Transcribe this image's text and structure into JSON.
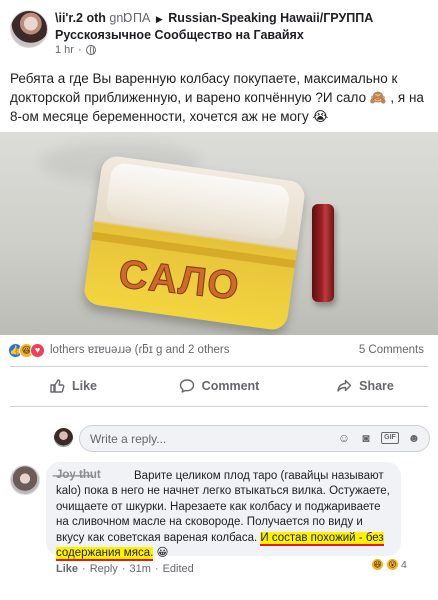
{
  "post": {
    "author_line": "\\ii'r.2 oth",
    "author_suffix": "ɡnⱰПА",
    "group_name": "Russian-Speaking Hawaii/ГРУППА Русскоязычное Сообщество на Гавайях",
    "time": "1 hr",
    "text": "Ребята а где Вы варенную колбасу покупаете, максимально к докторской приближенную, и варено копчённую ?И сало 🙈 , я на 8-ом месяце беременности, хочется аж не могу 😭",
    "photo_label": "CAЛO"
  },
  "reactions": {
    "summary": "lothers ɐɪɐuǝɹɹǝ (ɾƃɪ ɡ and 2 others",
    "comments_count": "5 Comments"
  },
  "actions": {
    "like": "Like",
    "comment": "Comment",
    "share": "Share"
  },
  "composer": {
    "placeholder": "Write a reply..."
  },
  "comment": {
    "author": "̶J̶o̶y̶ ̶t̶h̶ut",
    "text_plain": "Варите целиком плод таро (гавайцы называют kalo) пока в него не начнет легко втыкаться вилка. Остужаете, очищаете от шкурки. Нарезаете как колбасу и поджариваете на сливочном масле на сковороде. Получается по виду и вкусу как советская вареная колбаса. ",
    "text_highlight": "И состав похожий - без содержания мяса.",
    "text_end": " 😀",
    "reaction_count": "4",
    "like": "Like",
    "reply": "Reply",
    "time": "31m",
    "edited": "Edited"
  },
  "icons": {
    "like": "thumbs-up-icon",
    "comment": "speech-bubble-icon",
    "share": "share-arrow-icon",
    "globe": "globe-icon",
    "emoji": "emoji-icon",
    "camera": "camera-icon",
    "gif": "gif-icon",
    "sticker": "sticker-icon"
  },
  "colors": {
    "highlight": "#fff200",
    "underline": "#e51a1a",
    "link_blue": "#1877f2"
  }
}
